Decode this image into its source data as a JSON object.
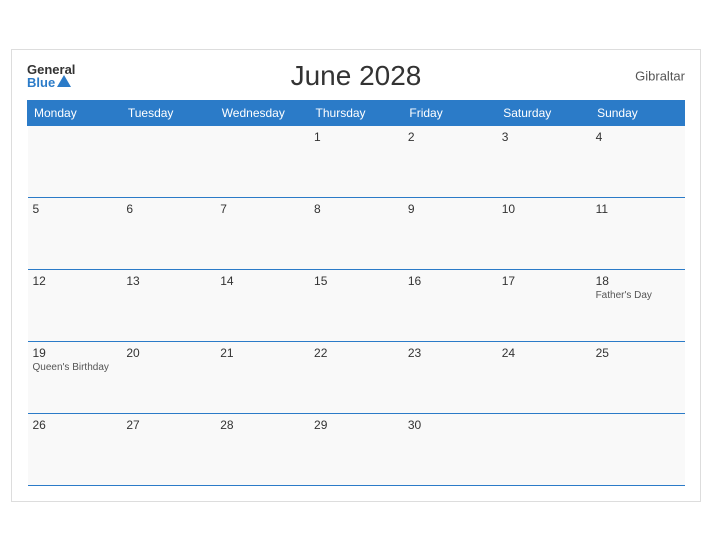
{
  "header": {
    "title": "June 2028",
    "region": "Gibraltar",
    "logo_general": "General",
    "logo_blue": "Blue"
  },
  "weekdays": [
    "Monday",
    "Tuesday",
    "Wednesday",
    "Thursday",
    "Friday",
    "Saturday",
    "Sunday"
  ],
  "weeks": [
    [
      {
        "date": "",
        "event": ""
      },
      {
        "date": "",
        "event": ""
      },
      {
        "date": "",
        "event": ""
      },
      {
        "date": "1",
        "event": ""
      },
      {
        "date": "2",
        "event": ""
      },
      {
        "date": "3",
        "event": ""
      },
      {
        "date": "4",
        "event": ""
      }
    ],
    [
      {
        "date": "5",
        "event": ""
      },
      {
        "date": "6",
        "event": ""
      },
      {
        "date": "7",
        "event": ""
      },
      {
        "date": "8",
        "event": ""
      },
      {
        "date": "9",
        "event": ""
      },
      {
        "date": "10",
        "event": ""
      },
      {
        "date": "11",
        "event": ""
      }
    ],
    [
      {
        "date": "12",
        "event": ""
      },
      {
        "date": "13",
        "event": ""
      },
      {
        "date": "14",
        "event": ""
      },
      {
        "date": "15",
        "event": ""
      },
      {
        "date": "16",
        "event": ""
      },
      {
        "date": "17",
        "event": ""
      },
      {
        "date": "18",
        "event": "Father's Day"
      }
    ],
    [
      {
        "date": "19",
        "event": "Queen's Birthday"
      },
      {
        "date": "20",
        "event": ""
      },
      {
        "date": "21",
        "event": ""
      },
      {
        "date": "22",
        "event": ""
      },
      {
        "date": "23",
        "event": ""
      },
      {
        "date": "24",
        "event": ""
      },
      {
        "date": "25",
        "event": ""
      }
    ],
    [
      {
        "date": "26",
        "event": ""
      },
      {
        "date": "27",
        "event": ""
      },
      {
        "date": "28",
        "event": ""
      },
      {
        "date": "29",
        "event": ""
      },
      {
        "date": "30",
        "event": ""
      },
      {
        "date": "",
        "event": ""
      },
      {
        "date": "",
        "event": ""
      }
    ]
  ]
}
